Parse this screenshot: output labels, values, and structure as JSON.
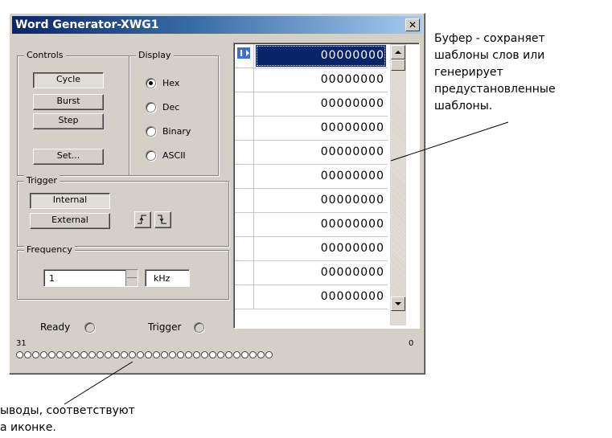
{
  "window": {
    "title": "Word Generator-XWG1",
    "close_label": "✕"
  },
  "controls": {
    "legend": "Controls",
    "cycle": "Cycle",
    "burst": "Burst",
    "step": "Step",
    "set": "Set..."
  },
  "display": {
    "legend": "Display",
    "options": [
      "Hex",
      "Dec",
      "Binary",
      "ASCII"
    ],
    "selected": "Hex"
  },
  "trigger": {
    "legend": "Trigger",
    "internal": "Internal",
    "external": "External",
    "selected": "Internal",
    "edge_rising_icon": "rising-edge-icon",
    "edge_falling_icon": "falling-edge-icon"
  },
  "frequency": {
    "legend": "Frequency",
    "value": "1",
    "unit": "kHz"
  },
  "status": {
    "ready": "Ready",
    "trigger": "Trigger"
  },
  "pins": {
    "left_label": "31",
    "right_label": "0",
    "count": 32
  },
  "buffer": {
    "rows": [
      "00000000",
      "00000000",
      "00000000",
      "00000000",
      "00000000",
      "00000000",
      "00000000",
      "00000000",
      "00000000",
      "00000000",
      "00000000"
    ],
    "selected_index": 0
  },
  "annotations": {
    "buffer_note_lines": [
      "Буфер - сохраняет",
      "шаблоны слов или",
      "генерирует",
      "предустановленные",
      "шаблоны."
    ],
    "pins_note_lines": [
      "ыводы, соответствуют",
      "а иконке."
    ]
  }
}
